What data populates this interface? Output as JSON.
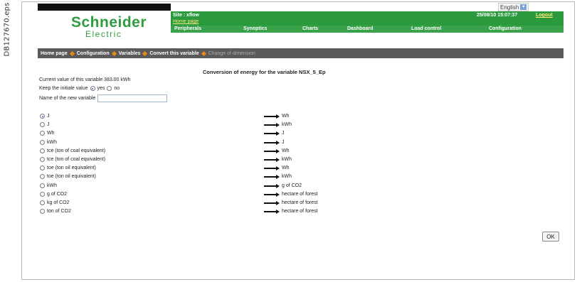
{
  "side_label": "DB127670.eps",
  "language": {
    "selected": "English"
  },
  "brand": {
    "name": "Schneider",
    "sub": "Electric"
  },
  "header": {
    "site": "Site : xflow",
    "home_link": "Home page",
    "datetime": "25/08/10 15:07:37",
    "logout": "Logout"
  },
  "tabs": [
    "Peripherals",
    "Synoptics",
    "Charts",
    "Dashboard",
    "Load control",
    "Configuration"
  ],
  "breadcrumb": [
    "Home page",
    "Configuration",
    "Variables",
    "Convert this variable",
    "Change of dimension"
  ],
  "page_title": "Conversion of energy for the variable NSX_5_Ep",
  "current_value": "Current value of this variable 383.00 kWh",
  "keep": {
    "label": "Keep the initiale value",
    "yes": "yes",
    "no": "no",
    "selected": "yes"
  },
  "new_name": {
    "label": "Name of the new variable",
    "value": ""
  },
  "conversions": [
    {
      "from": "J",
      "to": "Wh",
      "selected": true
    },
    {
      "from": "J",
      "to": "kWh",
      "selected": false
    },
    {
      "from": "Wh",
      "to": "J",
      "selected": false
    },
    {
      "from": "kWh",
      "to": "J",
      "selected": false
    },
    {
      "from": "tce (ton of coal equivalent)",
      "to": "Wh",
      "selected": false
    },
    {
      "from": "tce (ton of coal equivalent)",
      "to": "kWh",
      "selected": false
    },
    {
      "from": "toe (ton oil equivalent)",
      "to": "Wh",
      "selected": false
    },
    {
      "from": "toe (ton oil equivalent)",
      "to": "kWh",
      "selected": false
    },
    {
      "from": "kWh",
      "to": "g of CO2",
      "selected": false
    },
    {
      "from": "g of CO2",
      "to": "hectare of forest",
      "selected": false
    },
    {
      "from": "kg of CO2",
      "to": "hectare of forest",
      "selected": false
    },
    {
      "from": "ton of CO2",
      "to": "hectare of forest",
      "selected": false
    }
  ],
  "ok_label": "OK"
}
